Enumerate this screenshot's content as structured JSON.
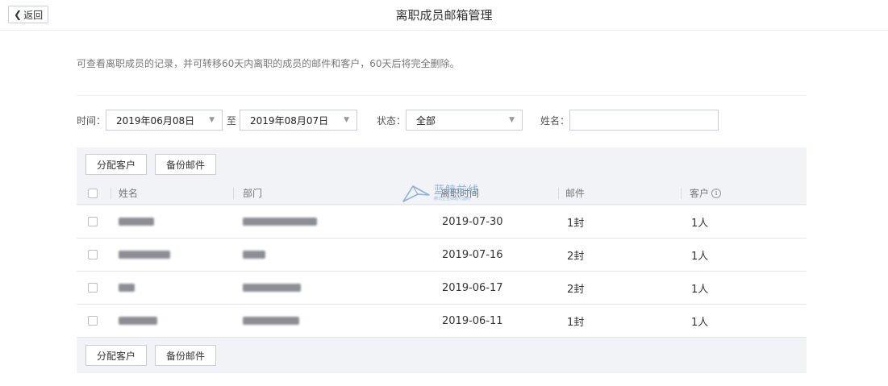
{
  "header": {
    "back_label": "返回",
    "title": "离职成员邮箱管理"
  },
  "description": "可查看离职成员的记录，并可转移60天内离职的成员的邮件和客户，60天后将完全删除。",
  "filters": {
    "time_label": "时间：",
    "start_date": "2019年06月08日",
    "to_label": "至",
    "end_date": "2019年08月07日",
    "status_label": "状态：",
    "status_value": "全部",
    "name_label": "姓名：",
    "name_value": ""
  },
  "toolbar": {
    "assign_label": "分配客户",
    "backup_label": "备份邮件"
  },
  "table": {
    "columns": {
      "name": "姓名",
      "dept": "部门",
      "time": "离职时间",
      "mail": "邮件",
      "customer": "客户"
    },
    "rows": [
      {
        "time": "2019-07-30",
        "mail": "1封",
        "customer": "1人"
      },
      {
        "time": "2019-07-16",
        "mail": "2封",
        "customer": "1人"
      },
      {
        "time": "2019-06-17",
        "mail": "2封",
        "customer": "1人"
      },
      {
        "time": "2019-06-11",
        "mail": "1封",
        "customer": "1人"
      }
    ]
  },
  "watermark": {
    "main": "蓝鲸前线",
    "sub": "腾讯企业邮箱代理商"
  },
  "icons": {
    "back": "chevron-left-icon",
    "dropdown": "caret-down-icon",
    "info": "info-circle-icon",
    "checkbox": "checkbox-icon"
  },
  "colors": {
    "toolbar_background": "#f2f3f6",
    "border": "#c9ced6",
    "watermark": "#6b9bd2"
  }
}
